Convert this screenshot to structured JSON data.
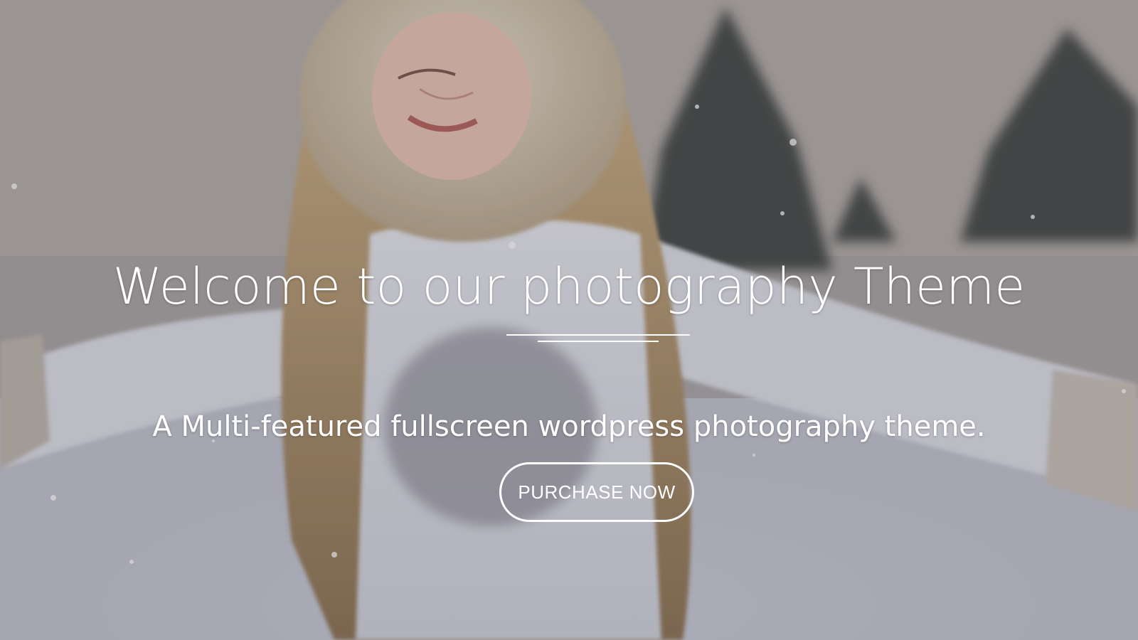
{
  "hero": {
    "title": "Welcome to our photography Theme",
    "subtitle": "A Multi-featured fullscreen wordpress photography theme.",
    "cta_label": "PURCHASE NOW",
    "background_image": "girl-in-snow-photo",
    "colors": {
      "text": "#ffffff",
      "button_border": "#ffffff"
    }
  }
}
